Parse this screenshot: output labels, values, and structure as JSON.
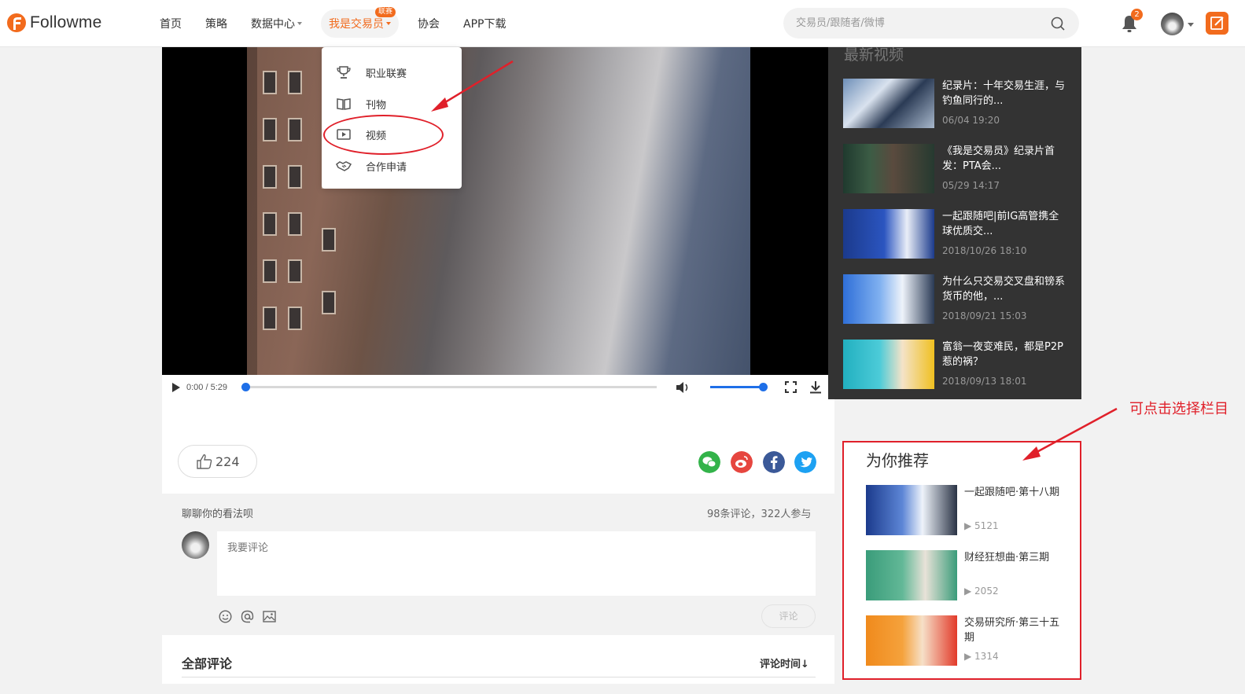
{
  "header": {
    "logo_text": "Followme",
    "nav": [
      {
        "label": "首页"
      },
      {
        "label": "策略"
      },
      {
        "label": "数据中心"
      },
      {
        "label": "我是交易员",
        "badge": "联赛"
      },
      {
        "label": "协会"
      },
      {
        "label": "APP下载"
      }
    ],
    "search_placeholder": "交易员/跟随者/微博",
    "notification_count": "2"
  },
  "dropdown": {
    "items": [
      {
        "label": "职业联赛",
        "icon": "trophy-icon"
      },
      {
        "label": "刊物",
        "icon": "book-icon"
      },
      {
        "label": "视频",
        "icon": "video-icon"
      },
      {
        "label": "合作申请",
        "icon": "handshake-icon"
      }
    ]
  },
  "player": {
    "time": "0:00 / 5:29",
    "progress": 0,
    "volume": 1.0
  },
  "latest": {
    "title": "最新视频",
    "items": [
      {
        "title": "纪录片：十年交易生涯，与钓鱼同行的...",
        "date": "06/04 19:20"
      },
      {
        "title": "《我是交易员》纪录片首发：PTA会...",
        "date": "05/29 14:17"
      },
      {
        "title": "一起跟随吧|前IG高管携全球优质交...",
        "date": "2018/10/26 18:10"
      },
      {
        "title": "为什么只交易交叉盘和镑系货币的他，...",
        "date": "2018/09/21 15:03"
      },
      {
        "title": "富翁一夜变难民，都是P2P惹的祸？",
        "date": "2018/09/13 18:01"
      }
    ]
  },
  "engagement": {
    "likes": "224"
  },
  "comments": {
    "label": "聊聊你的看法呗",
    "stats": "98条评论，322人参与",
    "placeholder": "我要评论",
    "submit_label": "评论",
    "all_title": "全部评论",
    "sort_label": "评论时间↓"
  },
  "recommend": {
    "title": "为你推荐",
    "items": [
      {
        "title": "一起跟随吧·第十八期",
        "views": "5121"
      },
      {
        "title": "财经狂想曲·第三期",
        "views": "2052"
      },
      {
        "title": "交易研究所·第三十五期",
        "views": "1314"
      }
    ]
  },
  "annotation": {
    "text": "可点击选择栏目",
    "color": "#e0202a"
  },
  "colors": {
    "brand": "#f26b1d",
    "accent_blue": "#1e6fe8"
  }
}
